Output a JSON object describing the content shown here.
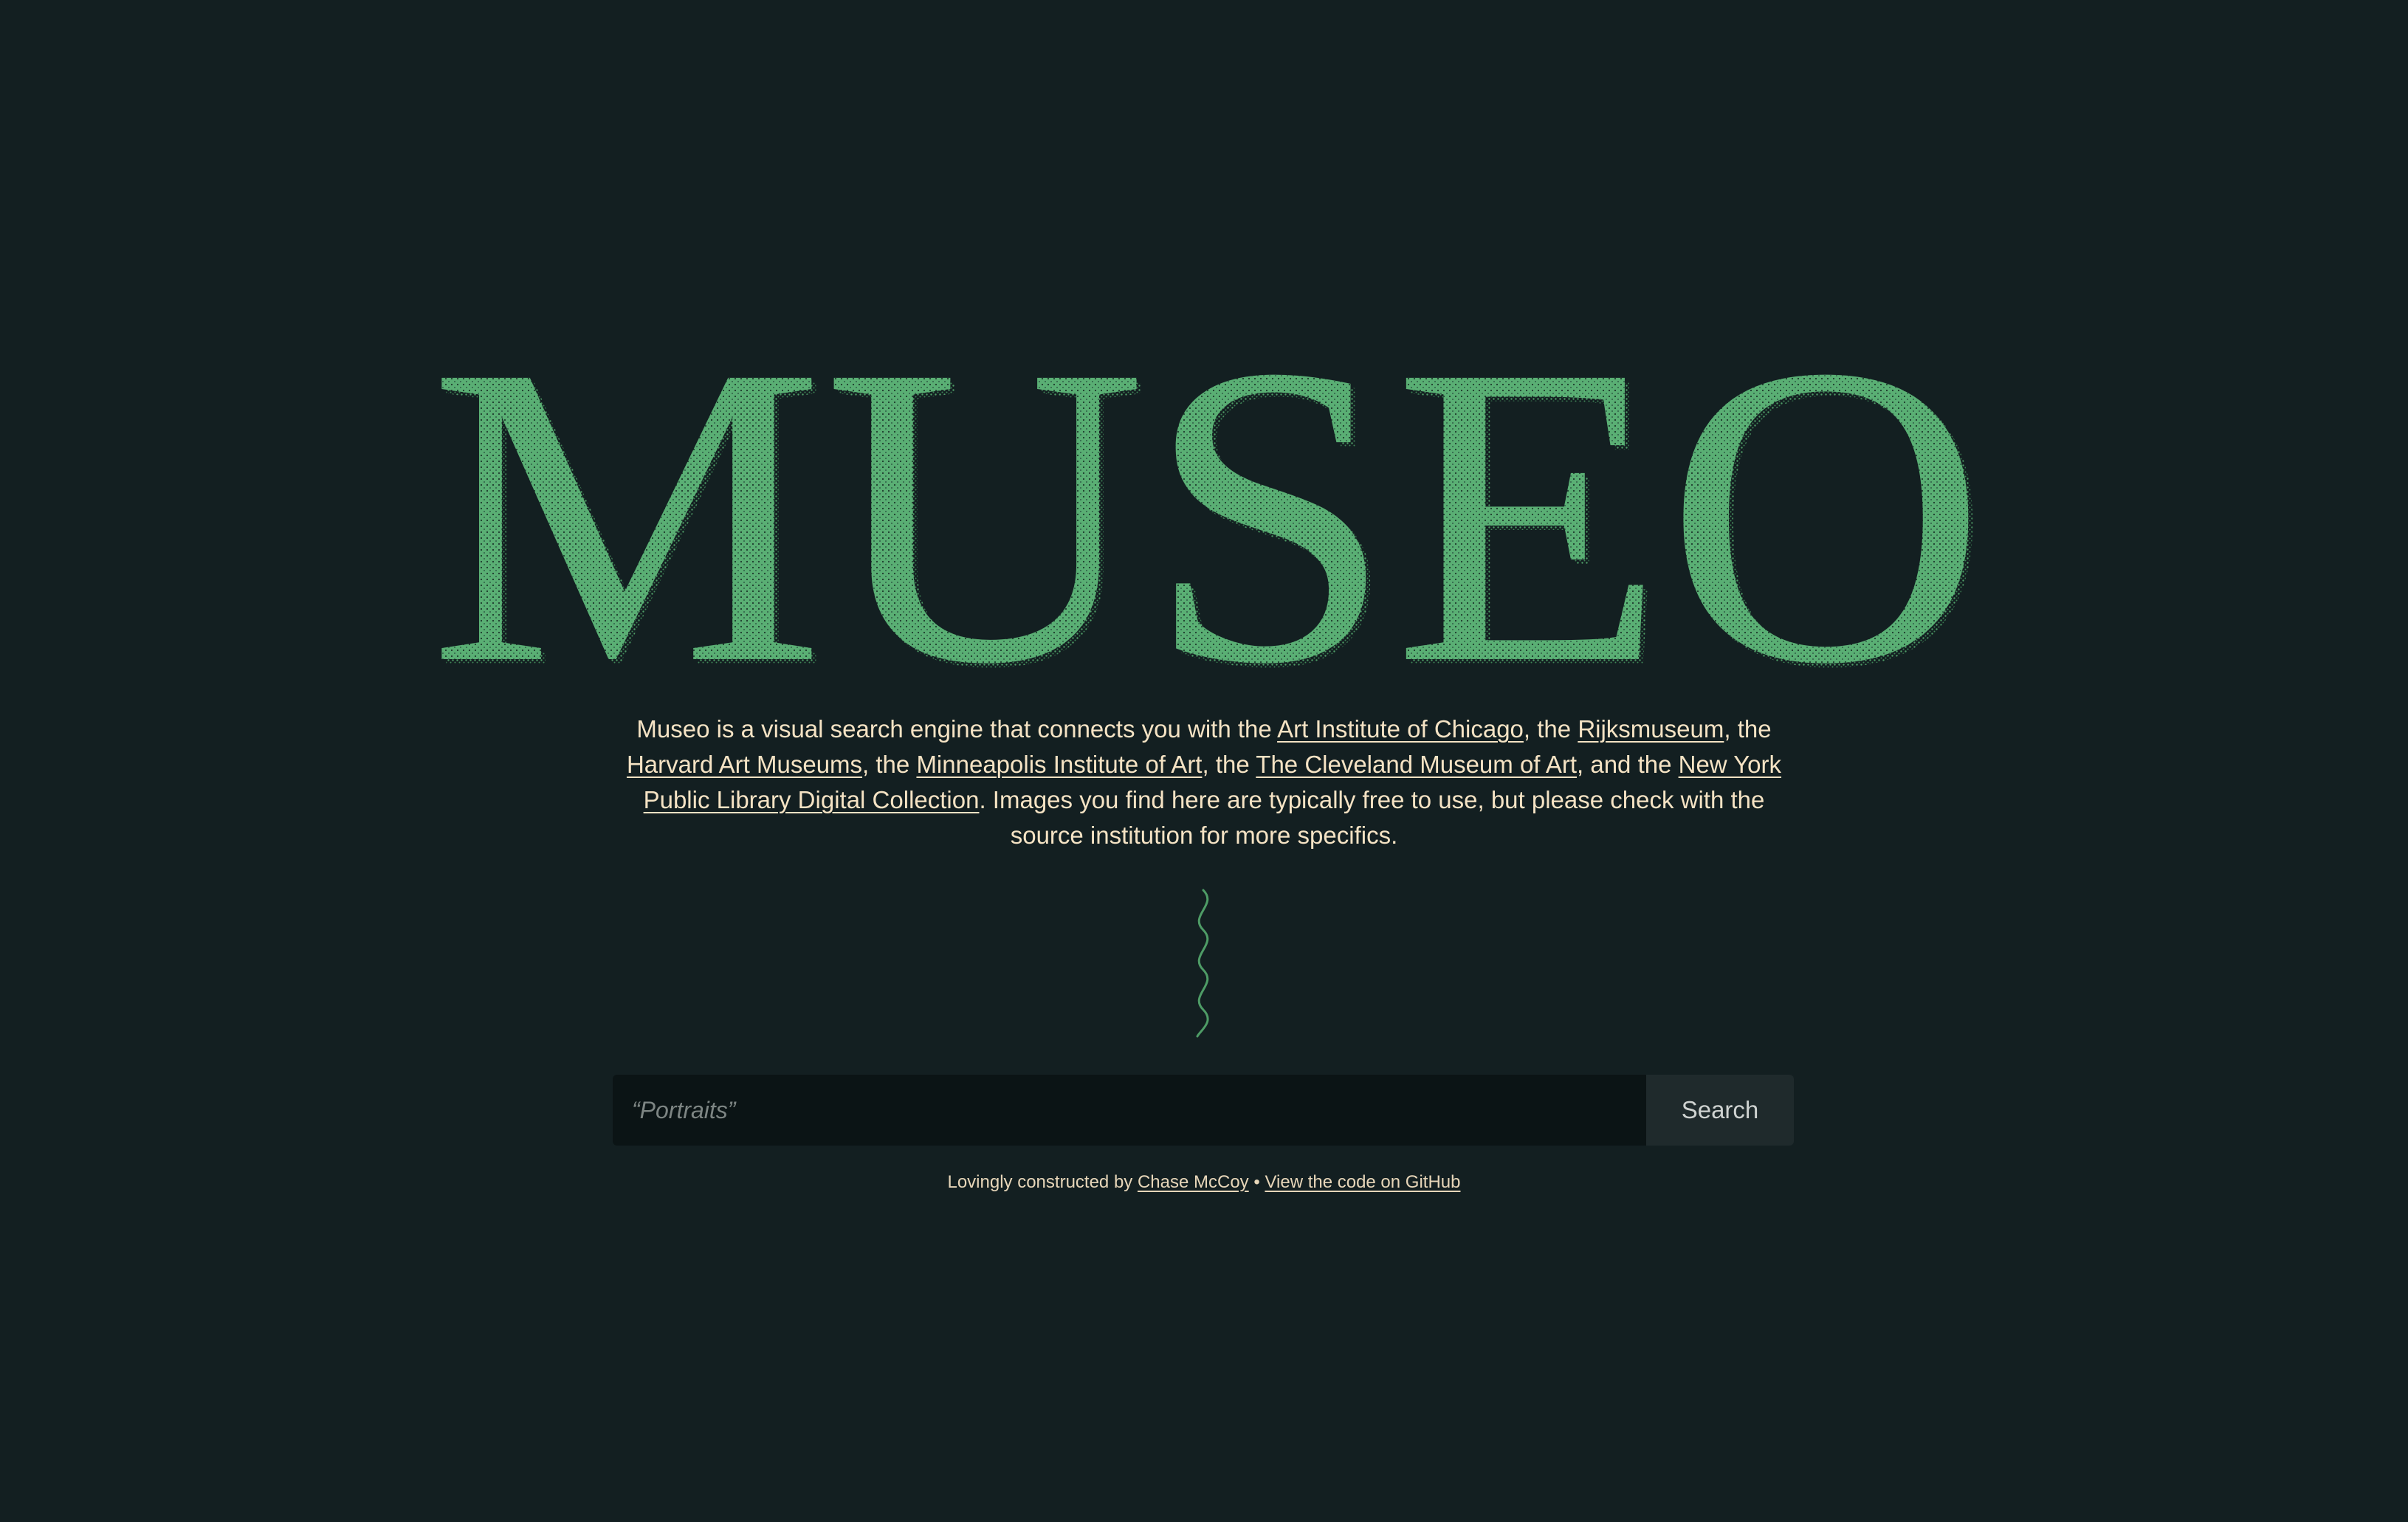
{
  "brand": {
    "wordmark": "MUSEO",
    "accent_color": "#5aaf74",
    "background_color": "#131f21",
    "text_color": "#f5e3c4"
  },
  "intro": {
    "t1": "Museo is a visual search engine that connects you with the ",
    "link_aic": "Art Institute of Chicago",
    "t2": ", the ",
    "link_rijks": "Rijksmuseum",
    "t3": ", the ",
    "link_harvard": "Harvard Art Museums",
    "t4": ", the ",
    "link_mia": "Minneapolis Institute of Art",
    "t5": ", the ",
    "link_cleveland": "The Cleveland Museum of Art",
    "t6": ", and the ",
    "link_nypl": "New York Public Library Digital Collection",
    "t7": ". Images you find here are typically free to use, but please check with the source institution for more specifics."
  },
  "search": {
    "placeholder": "“Portraits”",
    "value": "",
    "button_label": "Search"
  },
  "footer": {
    "prefix": "Lovingly constructed by ",
    "author_link": "Chase McCoy",
    "separator": " • ",
    "github_link": "View the code on GitHub"
  },
  "icons": {
    "divider": "squiggle-divider-icon"
  }
}
